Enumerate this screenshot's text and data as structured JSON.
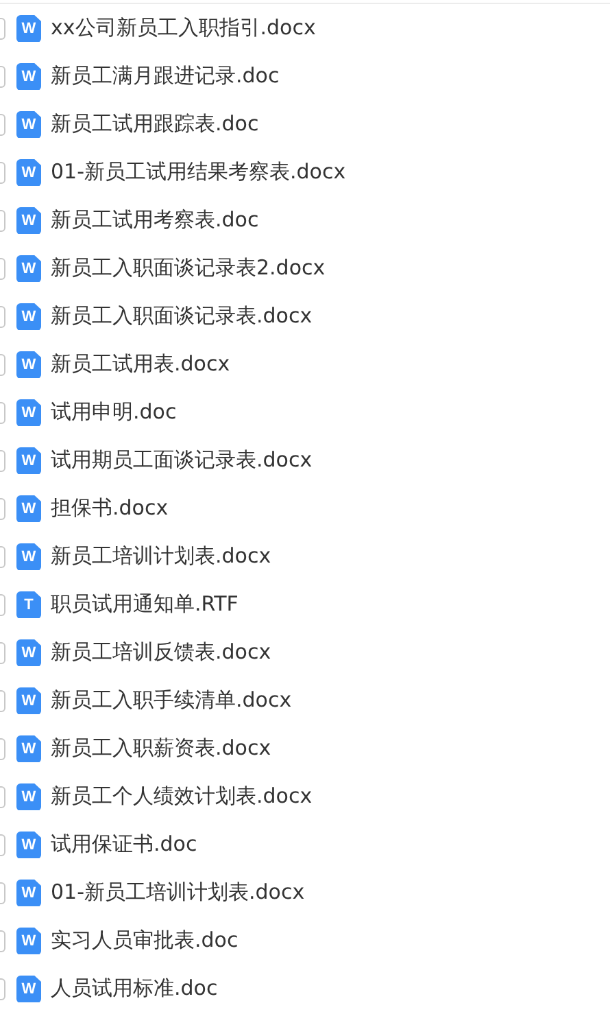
{
  "files": [
    {
      "badge": "W",
      "name": "xx公司新员工入职指引.docx",
      "checked": false
    },
    {
      "badge": "W",
      "name": "新员工满月跟进记录.doc",
      "checked": false
    },
    {
      "badge": "W",
      "name": "新员工试用跟踪表.doc",
      "checked": false
    },
    {
      "badge": "W",
      "name": "01-新员工试用结果考察表.docx",
      "checked": false
    },
    {
      "badge": "W",
      "name": "新员工试用考察表.doc",
      "checked": false
    },
    {
      "badge": "W",
      "name": "新员工入职面谈记录表2.docx",
      "checked": false
    },
    {
      "badge": "W",
      "name": "新员工入职面谈记录表.docx",
      "checked": false
    },
    {
      "badge": "W",
      "name": "新员工试用表.docx",
      "checked": false
    },
    {
      "badge": "W",
      "name": "试用申明.doc",
      "checked": false
    },
    {
      "badge": "W",
      "name": "试用期员工面谈记录表.docx",
      "checked": false
    },
    {
      "badge": "W",
      "name": "担保书.docx",
      "checked": false
    },
    {
      "badge": "W",
      "name": "新员工培训计划表.docx",
      "checked": false
    },
    {
      "badge": "T",
      "name": "职员试用通知单.RTF",
      "checked": false
    },
    {
      "badge": "W",
      "name": "新员工培训反馈表.docx",
      "checked": false
    },
    {
      "badge": "W",
      "name": "新员工入职手续清单.docx",
      "checked": false
    },
    {
      "badge": "W",
      "name": "新员工入职薪资表.docx",
      "checked": false
    },
    {
      "badge": "W",
      "name": "新员工个人绩效计划表.docx",
      "checked": false
    },
    {
      "badge": "W",
      "name": "试用保证书.doc",
      "checked": false
    },
    {
      "badge": "W",
      "name": "01-新员工培训计划表.docx",
      "checked": false
    },
    {
      "badge": "W",
      "name": "实习人员审批表.doc",
      "checked": false
    },
    {
      "badge": "W",
      "name": "人员试用标准.doc",
      "checked": false
    }
  ]
}
